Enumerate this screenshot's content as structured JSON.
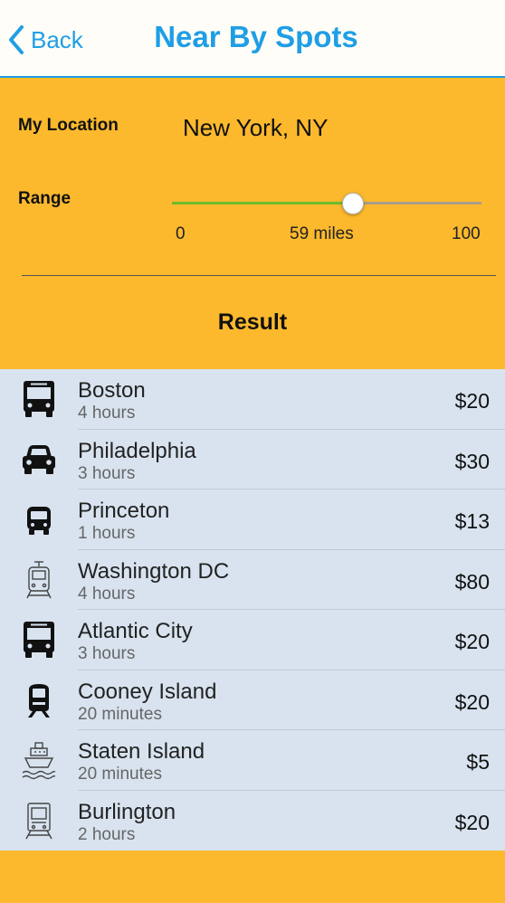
{
  "nav": {
    "back_label": "Back",
    "title": "Near By Spots"
  },
  "filters": {
    "location_label": "My Location",
    "location_value": "New York, NY",
    "range_label": "Range",
    "range_min": "0",
    "range_value": "59 miles",
    "range_max": "100",
    "range_fraction": 0.59
  },
  "result_heading": "Result",
  "colors": {
    "accent": "#1f9ee6",
    "panel": "#fcb92d",
    "list_bg": "#d8e3ef",
    "slider_fill": "#6dbb2b"
  },
  "results": [
    {
      "icon": "bus-icon",
      "name": "Boston",
      "duration": "4 hours",
      "price": "$20"
    },
    {
      "icon": "car-icon",
      "name": "Philadelphia",
      "duration": "3 hours",
      "price": "$30"
    },
    {
      "icon": "bus-front-icon",
      "name": "Princeton",
      "duration": "1 hours",
      "price": "$13"
    },
    {
      "icon": "tram-outline-icon",
      "name": "Washington DC",
      "duration": "4 hours",
      "price": "$80"
    },
    {
      "icon": "bus-icon",
      "name": "Atlantic City",
      "duration": "3 hours",
      "price": "$20"
    },
    {
      "icon": "train-icon",
      "name": "Cooney Island",
      "duration": "20 minutes",
      "price": "$20"
    },
    {
      "icon": "ferry-icon",
      "name": "Staten Island",
      "duration": "20 minutes",
      "price": "$5"
    },
    {
      "icon": "train-outline-icon",
      "name": "Burlington",
      "duration": "2 hours",
      "price": "$20"
    }
  ]
}
